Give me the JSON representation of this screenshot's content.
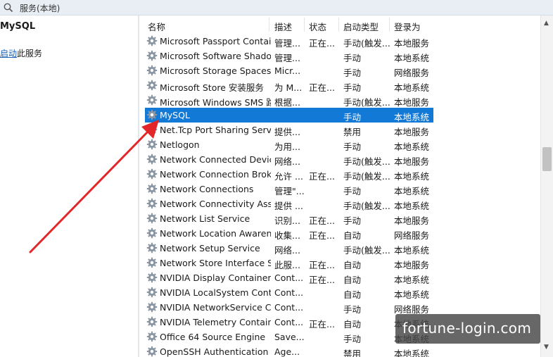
{
  "window": {
    "title": "服务(本地)"
  },
  "left_pane": {
    "service_name": "MySQL",
    "action_link": "启动",
    "action_suffix": "此服务"
  },
  "columns": [
    "名称",
    "描述",
    "状态",
    "启动类型",
    "登录为"
  ],
  "rows": [
    {
      "name": "Microsoft Passport Container",
      "desc": "管理...",
      "status": "正在...",
      "start": "手动(触发...",
      "logon": "本地服务"
    },
    {
      "name": "Microsoft Software Shado...",
      "desc": "管理...",
      "status": "",
      "start": "手动",
      "logon": "本地系统"
    },
    {
      "name": "Microsoft Storage Spaces S...",
      "desc": "Micr...",
      "status": "",
      "start": "手动",
      "logon": "网络服务"
    },
    {
      "name": "Microsoft Store 安装服务",
      "desc": "为 M...",
      "status": "正在...",
      "start": "手动",
      "logon": "本地系统"
    },
    {
      "name": "Microsoft Windows SMS 路...",
      "desc": "根据...",
      "status": "",
      "start": "手动(触发...",
      "logon": "本地服务"
    },
    {
      "name": "MySQL",
      "desc": "",
      "status": "",
      "start": "手动",
      "logon": "本地系统",
      "selected": true
    },
    {
      "name": "Net.Tcp Port Sharing Service",
      "desc": "提供...",
      "status": "",
      "start": "禁用",
      "logon": "本地服务"
    },
    {
      "name": "Netlogon",
      "desc": "为用...",
      "status": "",
      "start": "手动",
      "logon": "本地系统"
    },
    {
      "name": "Network Connected Devic...",
      "desc": "网络...",
      "status": "",
      "start": "手动(触发...",
      "logon": "本地服务"
    },
    {
      "name": "Network Connection Broker",
      "desc": "允许 ...",
      "status": "正在...",
      "start": "手动(触发...",
      "logon": "本地系统"
    },
    {
      "name": "Network Connections",
      "desc": "管理\"...",
      "status": "",
      "start": "手动",
      "logon": "本地系统"
    },
    {
      "name": "Network Connectivity Assis...",
      "desc": "提供 ...",
      "status": "",
      "start": "手动(触发...",
      "logon": "本地系统"
    },
    {
      "name": "Network List Service",
      "desc": "识别...",
      "status": "正在...",
      "start": "手动",
      "logon": "本地服务"
    },
    {
      "name": "Network Location Awarene...",
      "desc": "收集...",
      "status": "正在...",
      "start": "自动",
      "logon": "网络服务"
    },
    {
      "name": "Network Setup Service",
      "desc": "网络...",
      "status": "",
      "start": "手动(触发...",
      "logon": "本地系统"
    },
    {
      "name": "Network Store Interface Se...",
      "desc": "此服...",
      "status": "正在...",
      "start": "自动",
      "logon": "本地服务"
    },
    {
      "name": "NVIDIA Display Container LS",
      "desc": "Cont...",
      "status": "正在...",
      "start": "自动",
      "logon": "本地系统"
    },
    {
      "name": "NVIDIA LocalSystem Conta...",
      "desc": "Cont...",
      "status": "",
      "start": "自动",
      "logon": "本地系统"
    },
    {
      "name": "NVIDIA NetworkService C...",
      "desc": "Cont...",
      "status": "",
      "start": "手动",
      "logon": "网络服务"
    },
    {
      "name": "NVIDIA Telemetry Container",
      "desc": "Cont...",
      "status": "正在...",
      "start": "自动",
      "logon": "本地系统"
    },
    {
      "name": "Office 64 Source Engine",
      "desc": "Save...",
      "status": "",
      "start": "手动",
      "logon": "本地系统"
    },
    {
      "name": "OpenSSH Authentication ...",
      "desc": "Age...",
      "status": "",
      "start": "禁用",
      "logon": "本地系统"
    }
  ],
  "watermark": "fortune-login.com",
  "colors": {
    "selection": "#1379d6",
    "arrow": "#e2262a",
    "link": "#1a5fb4"
  },
  "icons": {
    "service": "gear-icon",
    "search": "search-icon"
  }
}
